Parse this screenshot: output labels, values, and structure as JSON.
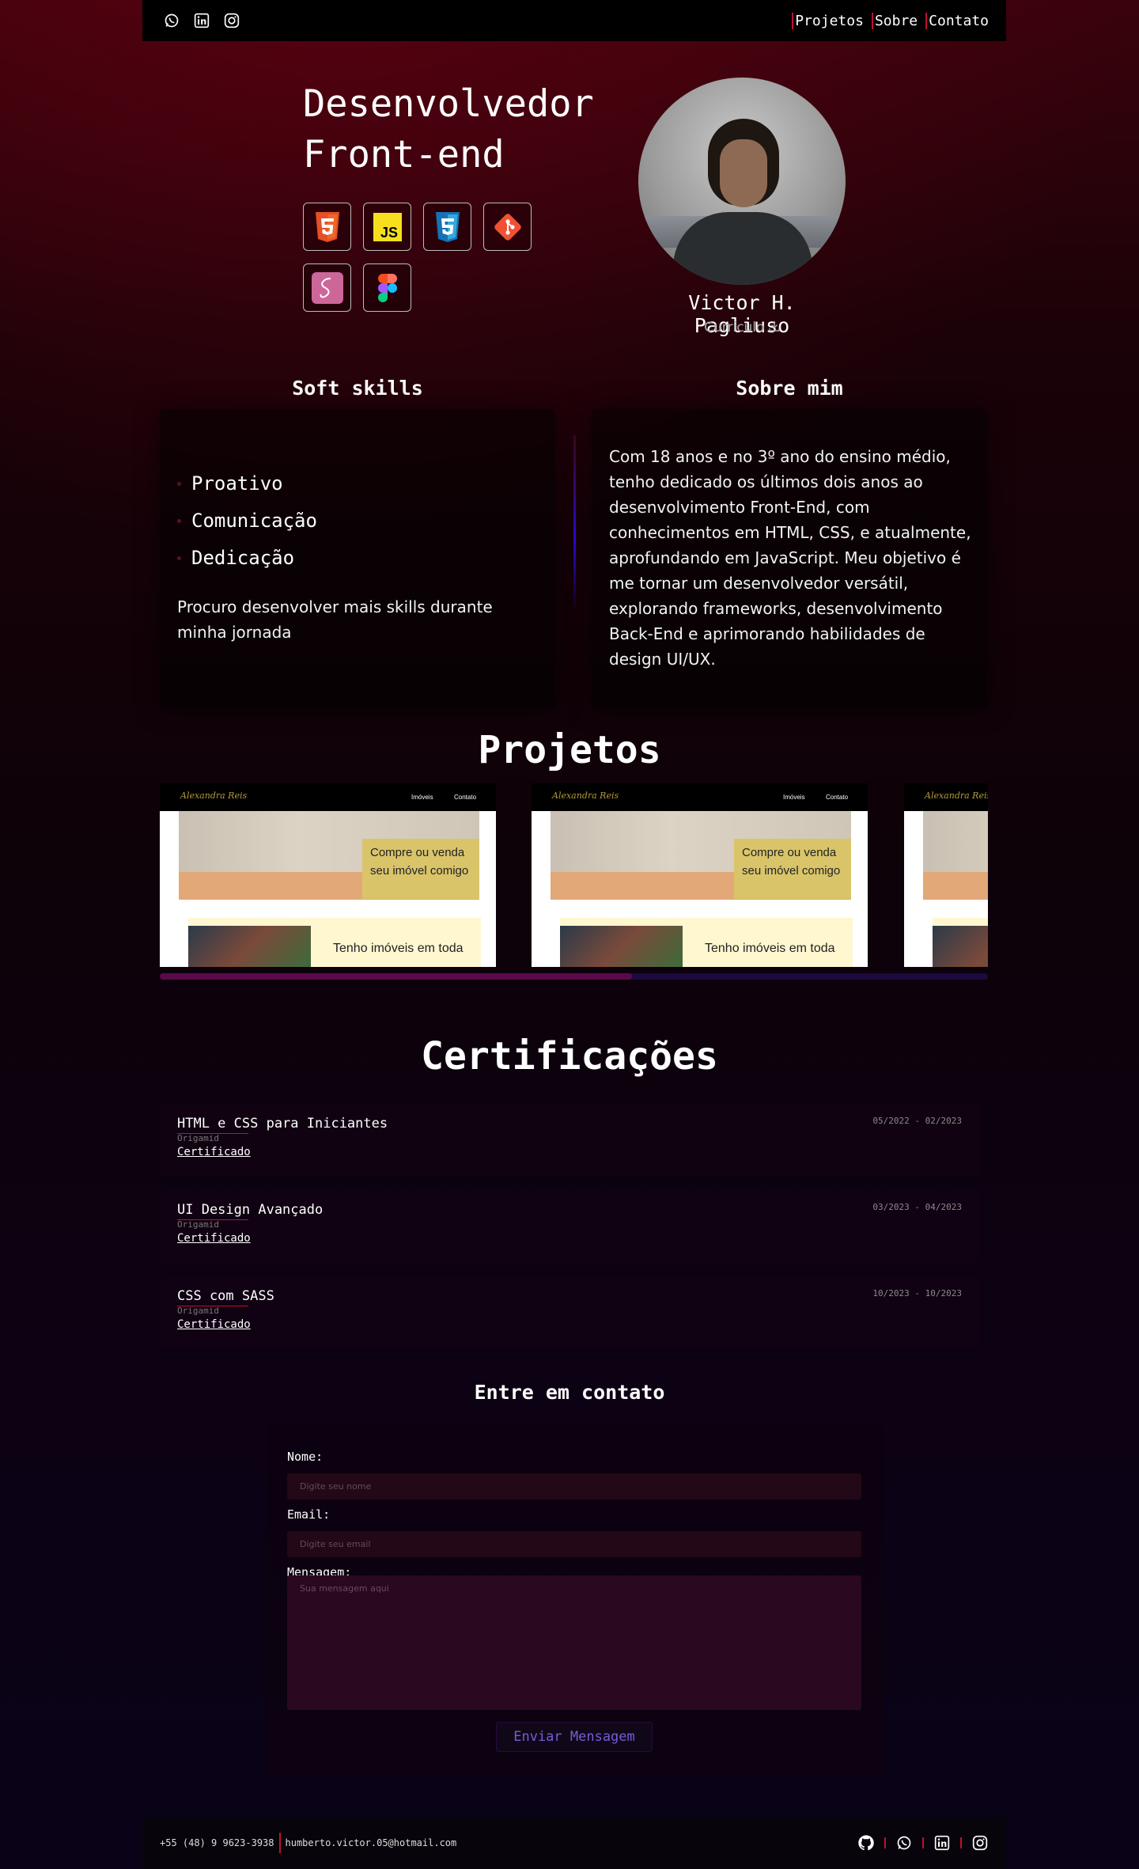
{
  "nav": {
    "social_icons": [
      "whatsapp-icon",
      "linkedin-icon",
      "instagram-icon"
    ],
    "links": [
      "Projetos",
      "Sobre",
      "Contato"
    ]
  },
  "hero": {
    "title_line1": "Desenvolvedor",
    "title_line2": "Front-end",
    "tech_icons": [
      "html5-icon",
      "javascript-icon",
      "css3-icon",
      "git-icon",
      "sass-icon",
      "figma-icon"
    ],
    "name": "Victor H. Pagliuso",
    "cv_label": "Currículo"
  },
  "soft_skills": {
    "heading": "Soft skills",
    "items": [
      "Proativo",
      "Comunicação",
      "Dedicação"
    ],
    "note": "Procuro desenvolver mais skills durante minha jornada"
  },
  "about": {
    "heading": "Sobre mim",
    "text": "Com 18 anos e no 3º ano do ensino médio, tenho dedicado os últimos dois anos ao desenvolvimento Front-End, com conhecimentos em HTML, CSS, e atualmente, aprofundando em JavaScript. Meu objetivo é me tornar um desenvolvedor versátil, explorando frameworks, desenvolvimento Back-End e aprimorando habilidades de design UI/UX."
  },
  "projects": {
    "heading": "Projetos",
    "slides": [
      {
        "logo": "Alexandra Reis",
        "nav1": "Imóveis",
        "nav2": "Contato",
        "callout": "Compre ou venda seu imóvel comigo",
        "bottom": "Tenho imóveis em toda"
      },
      {
        "logo": "Alexandra Reis",
        "nav1": "Imóveis",
        "nav2": "Contato",
        "callout": "Compre ou venda seu imóvel comigo",
        "bottom": "Tenho imóveis em toda"
      },
      {
        "logo": "Alexandra Reis",
        "nav1": "",
        "nav2": "",
        "callout": "",
        "bottom": ""
      }
    ],
    "scroll_position": 0.57
  },
  "certifications": {
    "heading": "Certificações",
    "items": [
      {
        "name": "HTML e CSS para Iniciantes",
        "org": "Origamid",
        "link": "Certificado",
        "date": "05/2022 - 02/2023"
      },
      {
        "name": "UI Design Avançado",
        "org": "Origamid",
        "link": "Certificado",
        "date": "03/2023 - 04/2023"
      },
      {
        "name": "CSS com SASS",
        "org": "Origamid",
        "link": "Certificado",
        "date": "10/2023 - 10/2023"
      }
    ]
  },
  "contact": {
    "heading": "Entre em contato",
    "name_label": "Nome:",
    "name_placeholder": "Digite seu nome",
    "email_label": "Email:",
    "email_placeholder": "Digite seu email",
    "message_label": "Mensagem:",
    "message_placeholder": "Sua mensagem aqui",
    "submit": "Enviar Mensagem"
  },
  "footer": {
    "phone": "+55 (48) 9 9623-3938",
    "email": "humberto.victor.05@hotmail.com",
    "icons": [
      "github-icon",
      "whatsapp-icon",
      "linkedin-icon",
      "instagram-icon"
    ]
  },
  "colors": {
    "accent": "#c01030",
    "submit_text": "#7a5ad8"
  }
}
